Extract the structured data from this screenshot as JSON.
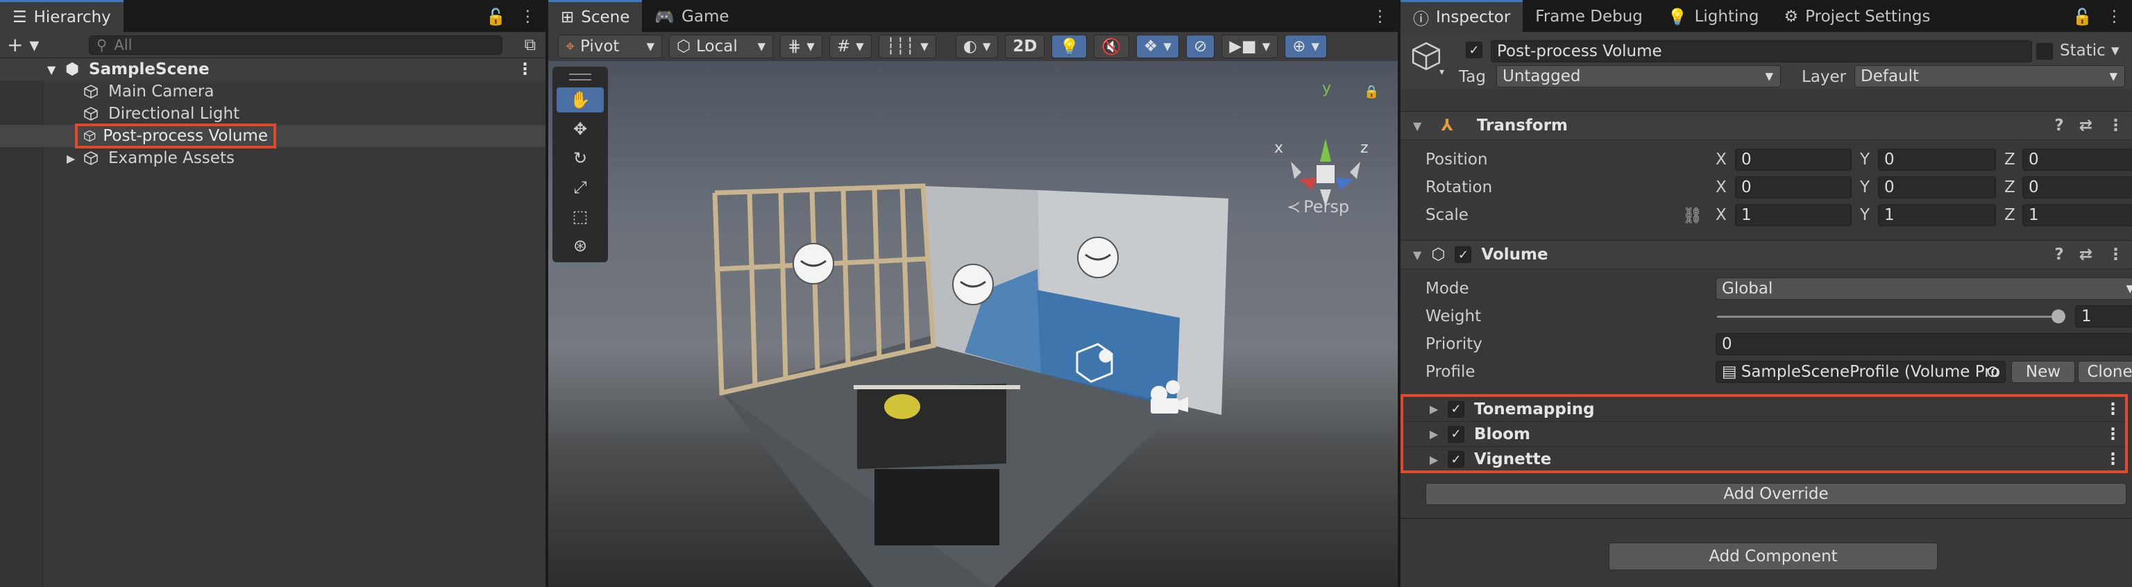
{
  "hierarchy": {
    "tab": "Hierarchy",
    "search_placeholder": "All",
    "scene": "SampleScene",
    "items": [
      {
        "label": "Main Camera"
      },
      {
        "label": "Directional Light"
      },
      {
        "label": "Post-process Volume"
      },
      {
        "label": "Example Assets"
      }
    ]
  },
  "scene_view": {
    "tabs": [
      "Scene",
      "Game"
    ],
    "pivot": "Pivot",
    "space": "Local",
    "mode2d": "2D",
    "persp": "Persp",
    "gizmo_axes": {
      "y": "y",
      "x": "x",
      "z": "z"
    }
  },
  "inspector": {
    "tabs": [
      "Inspector",
      "Frame Debug",
      "Lighting",
      "Project Settings"
    ],
    "object_name": "Post-process Volume",
    "static_label": "Static",
    "tag_label": "Tag",
    "tag_value": "Untagged",
    "layer_label": "Layer",
    "layer_value": "Default",
    "transform": {
      "title": "Transform",
      "position_label": "Position",
      "rotation_label": "Rotation",
      "scale_label": "Scale",
      "position": [
        "0",
        "0",
        "0"
      ],
      "rotation": [
        "0",
        "0",
        "0"
      ],
      "scale": [
        "1",
        "1",
        "1"
      ],
      "axes": [
        "X",
        "Y",
        "Z"
      ]
    },
    "volume": {
      "title": "Volume",
      "mode_label": "Mode",
      "mode_value": "Global",
      "weight_label": "Weight",
      "weight_value": "1",
      "priority_label": "Priority",
      "priority_value": "0",
      "profile_label": "Profile",
      "profile_value": "SampleSceneProfile (Volume Pro",
      "new_btn": "New",
      "clone_btn": "Clone"
    },
    "overrides": [
      "Tonemapping",
      "Bloom",
      "Vignette"
    ],
    "add_override": "Add Override",
    "add_component": "Add Component"
  },
  "colors": {
    "accent": "#3a79bb",
    "highlight": "#e04a2a"
  }
}
